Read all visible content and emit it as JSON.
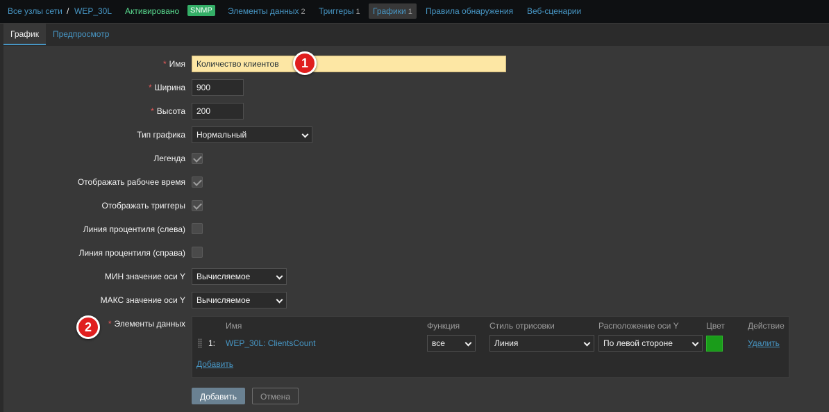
{
  "breadcrumbs": {
    "all_hosts": "Все узлы сети",
    "separator": "/",
    "host": "WEP_30L",
    "status": "Активировано",
    "snmp": "SNMP"
  },
  "nav": {
    "items_label": "Элементы данных",
    "items_count": "2",
    "triggers_label": "Триггеры",
    "triggers_count": "1",
    "graphs_label": "Графики",
    "graphs_count": "1",
    "discovery_label": "Правила обнаружения",
    "web_label": "Веб-сценарии"
  },
  "tabs": {
    "graph": "График",
    "preview": "Предпросмотр"
  },
  "form": {
    "required_mark": "*",
    "name_label": "Имя",
    "name_value": "Количество клиентов",
    "width_label": "Ширина",
    "width_value": "900",
    "height_label": "Высота",
    "height_value": "200",
    "graph_type_label": "Тип графика",
    "graph_type_value": "Нормальный",
    "legend_label": "Легенда",
    "legend_checked": true,
    "worktime_label": "Отображать рабочее время",
    "worktime_checked": true,
    "triggers_label": "Отображать триггеры",
    "triggers_checked": true,
    "percentile_left_label": "Линия процентиля (слева)",
    "percentile_left_checked": false,
    "percentile_right_label": "Линия процентиля (справа)",
    "percentile_right_checked": false,
    "ymin_label": "МИН значение оси Y",
    "ymin_value": "Вычисляемое",
    "ymax_label": "МАКС значение оси Y",
    "ymax_value": "Вычисляемое",
    "items_label": "Элементы данных"
  },
  "items_table": {
    "headers": {
      "name": "Имя",
      "function": "Функция",
      "draw_style": "Стиль отрисовки",
      "y_side": "Расположение оси Y",
      "color": "Цвет",
      "action": "Действие"
    },
    "rows": [
      {
        "index": "1:",
        "name": "WEP_30L: ClientsCount",
        "function": "все",
        "draw_style": "Линия",
        "y_side": "По левой стороне",
        "color": "#1a9c1a",
        "action": "Удалить"
      }
    ],
    "add_link": "Добавить"
  },
  "buttons": {
    "add": "Добавить",
    "cancel": "Отмена"
  },
  "markers": {
    "m1": "1",
    "m2": "2"
  },
  "colors": {
    "accent": "#4796c4",
    "enabled": "#59db8f",
    "required": "#e45959",
    "highlight_field": "#fde7a4",
    "marker": "#e01e1e"
  }
}
